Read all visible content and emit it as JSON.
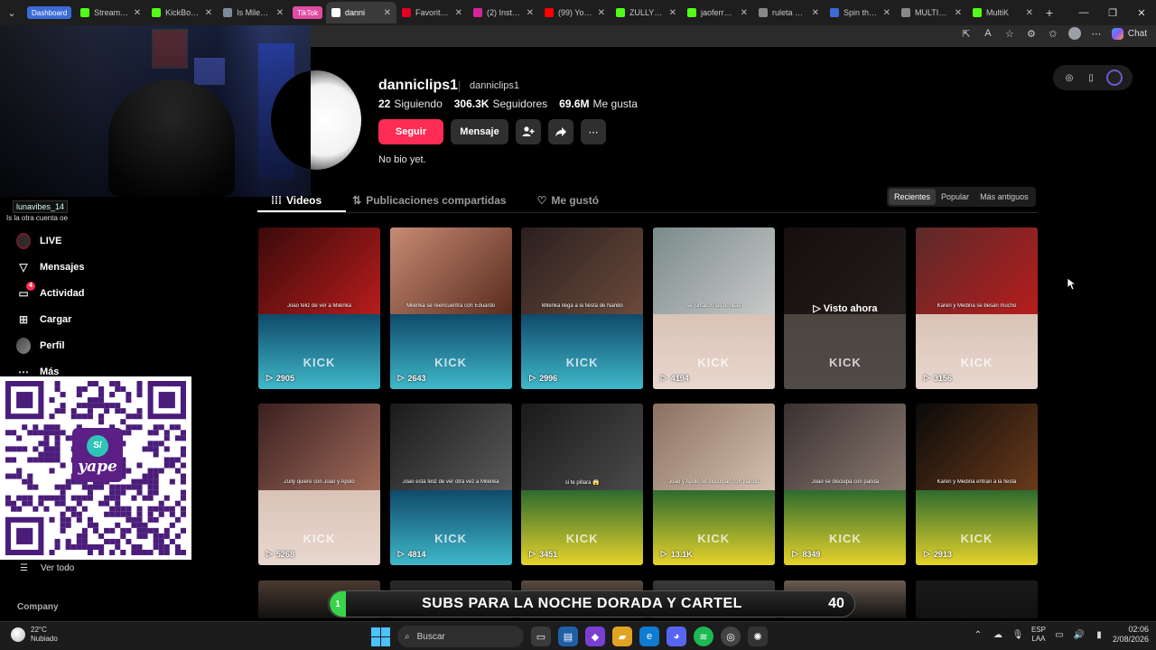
{
  "browser": {
    "tabs": [
      {
        "label": "Dashboard",
        "kind": "group",
        "color": "#3b6bd8"
      },
      {
        "label": "Stream - K",
        "icon": "kick-icon",
        "color": "#53fc18"
      },
      {
        "label": "KickBot TI",
        "icon": "kick-icon",
        "color": "#53fc18"
      },
      {
        "label": "Is Milenka",
        "icon": "globe-icon",
        "color": "#7c8b9c"
      },
      {
        "label": "TikTok",
        "kind": "group2",
        "color": "#e34ba3"
      },
      {
        "label": "danni",
        "icon": "tiktok-icon",
        "color": "#ffffff",
        "active": true
      },
      {
        "label": "Favoritos |",
        "icon": "pinterest-icon",
        "color": "#e60023"
      },
      {
        "label": "(2) Instagra",
        "icon": "instagram-icon",
        "color": "#d6249f"
      },
      {
        "label": "(99) YouTu",
        "icon": "youtube-icon",
        "color": "#ff0000"
      },
      {
        "label": "ZULLYY_C",
        "icon": "kick-icon",
        "color": "#53fc18"
      },
      {
        "label": "jaoferreira",
        "icon": "kick-icon",
        "color": "#53fc18"
      },
      {
        "label": "ruleta unli",
        "icon": "search-icon",
        "color": "#888888"
      },
      {
        "label": "Spin the W",
        "icon": "wheel-icon",
        "color": "#3b6bd8"
      },
      {
        "label": "MULTIKICK",
        "icon": "globe-icon",
        "color": "#888888"
      },
      {
        "label": "MultiK",
        "icon": "multikick-icon",
        "color": "#53fc18"
      }
    ],
    "chat_label": "Chat"
  },
  "stream_chat": {
    "name": "lunavibes_14",
    "message": "Is la otra cuenta oe"
  },
  "profile": {
    "username": "danniclips1",
    "nickname": "danniclips1",
    "stats": [
      {
        "value": "22",
        "label": "Siguiendo"
      },
      {
        "value": "306.3K",
        "label": "Seguidores"
      },
      {
        "value": "69.6M",
        "label": "Me gusta"
      }
    ],
    "follow_label": "Seguir",
    "message_label": "Mensaje",
    "bio": "No bio yet."
  },
  "content_tabs": [
    {
      "label": "Videos",
      "icon": "grid-icon",
      "active": true
    },
    {
      "label": "Publicaciones compartidas",
      "icon": "repost-icon"
    },
    {
      "label": "Me gustó",
      "icon": "heart-icon"
    }
  ],
  "sort_options": [
    {
      "label": "Recientes",
      "active": true
    },
    {
      "label": "Popular"
    },
    {
      "label": "Más antiguos"
    }
  ],
  "sidebar": {
    "items": [
      {
        "label": "LIVE",
        "icon": "live-icon"
      },
      {
        "label": "Mensajes",
        "icon": "send-icon"
      },
      {
        "label": "Actividad",
        "icon": "activity-icon",
        "badge": "4"
      },
      {
        "label": "Cargar",
        "icon": "upload-icon"
      },
      {
        "label": "Perfil",
        "icon": "profile-icon"
      },
      {
        "label": "Más",
        "icon": "more-icon"
      }
    ],
    "see_all": "Ver todo",
    "company": "Company"
  },
  "qr": {
    "brand": "yape",
    "coin": "S/"
  },
  "videos": [
    {
      "caption": "Joao feliz de ver a Milenka",
      "views": "2905",
      "top": [
        "#3a0a0a",
        "#b71c1c"
      ],
      "bottom": [
        "#0f4a6b",
        "#3fb8c9"
      ],
      "kick": "KICK"
    },
    {
      "caption": "Milenka se reencuentra con Eduardo",
      "views": "2643",
      "top": [
        "#c78b73",
        "#5a2b1e"
      ],
      "bottom": [
        "#0f4a6b",
        "#3fb8c9"
      ],
      "kick": "KICK"
    },
    {
      "caption": "Milenka llega a la fiesta de Nando",
      "views": "2996",
      "top": [
        "#2a1f1f",
        "#6b4a3a"
      ],
      "bottom": [
        "#0f4a6b",
        "#3fb8c9"
      ],
      "kick": "KICK"
    },
    {
      "caption": "se juntaron las bonitas",
      "views": "4194",
      "top": [
        "#7a8a8a",
        "#c9c9c9"
      ],
      "bottom": [
        "#d9c3b6",
        "#e8d7cf"
      ],
      "kick": "KICK"
    },
    {
      "caption": "",
      "views": "",
      "watched": "Visto ahora",
      "dim": true,
      "top": [
        "#3a2a2a",
        "#6b5050"
      ],
      "bottom": [
        "#d9c3b6",
        "#e8d7cf"
      ],
      "kick": "KICK"
    },
    {
      "caption": "Karen y Medina se besan mucho",
      "views": "3156",
      "top": [
        "#5a2a2a",
        "#b71c1c"
      ],
      "bottom": [
        "#d9c3b6",
        "#e8d7cf"
      ],
      "kick": "KICK"
    },
    {
      "caption": "Zully quiere con Joao y Apolo",
      "views": "5268",
      "top": [
        "#3a2020",
        "#a06a5a"
      ],
      "bottom": [
        "#d9c3b6",
        "#e8d7cf"
      ],
      "kick": "KICK"
    },
    {
      "caption": "Joao esta feliz de ver otra vez a Milenka",
      "views": "4814",
      "top": [
        "#1a1a1a",
        "#5a5a5a"
      ],
      "bottom": [
        "#0f4a6b",
        "#3fb8c9"
      ],
      "kick": "KICK"
    },
    {
      "caption": "si te pillara 😱",
      "views": "3451",
      "top": [
        "#1a1a1a",
        "#4a4a4a"
      ],
      "bottom": [
        "#2e6b2e",
        "#e6d32a"
      ],
      "kick": "KICK"
    },
    {
      "caption": "Joao y Apolo se disculpan con Nando",
      "views": "13.1K",
      "top": [
        "#8a7060",
        "#d6c0b0"
      ],
      "bottom": [
        "#2e6b2e",
        "#e6d32a"
      ],
      "kick": "KICK"
    },
    {
      "caption": "Joao se disculpa con panda",
      "views": "8349",
      "top": [
        "#3a3030",
        "#8a7a70"
      ],
      "bottom": [
        "#2e6b2e",
        "#e6d32a"
      ],
      "kick": "KICK"
    },
    {
      "caption": "Karen y Medina entran a la fiesta",
      "views": "2913",
      "top": [
        "#0a0a0a",
        "#6a3a1a"
      ],
      "bottom": [
        "#2e6b2e",
        "#e6d32a"
      ],
      "kick": "KICK"
    }
  ],
  "banner": {
    "left": "1",
    "text": "SUBS PARA LA NOCHE DORADA Y CARTEL",
    "count": "40"
  },
  "taskbar": {
    "temp": "22°C",
    "weather": "Nubiado",
    "search": "Buscar",
    "lang1": "ESP",
    "lang2": "LAA",
    "time": "02:06",
    "date": "2/08/2026"
  }
}
